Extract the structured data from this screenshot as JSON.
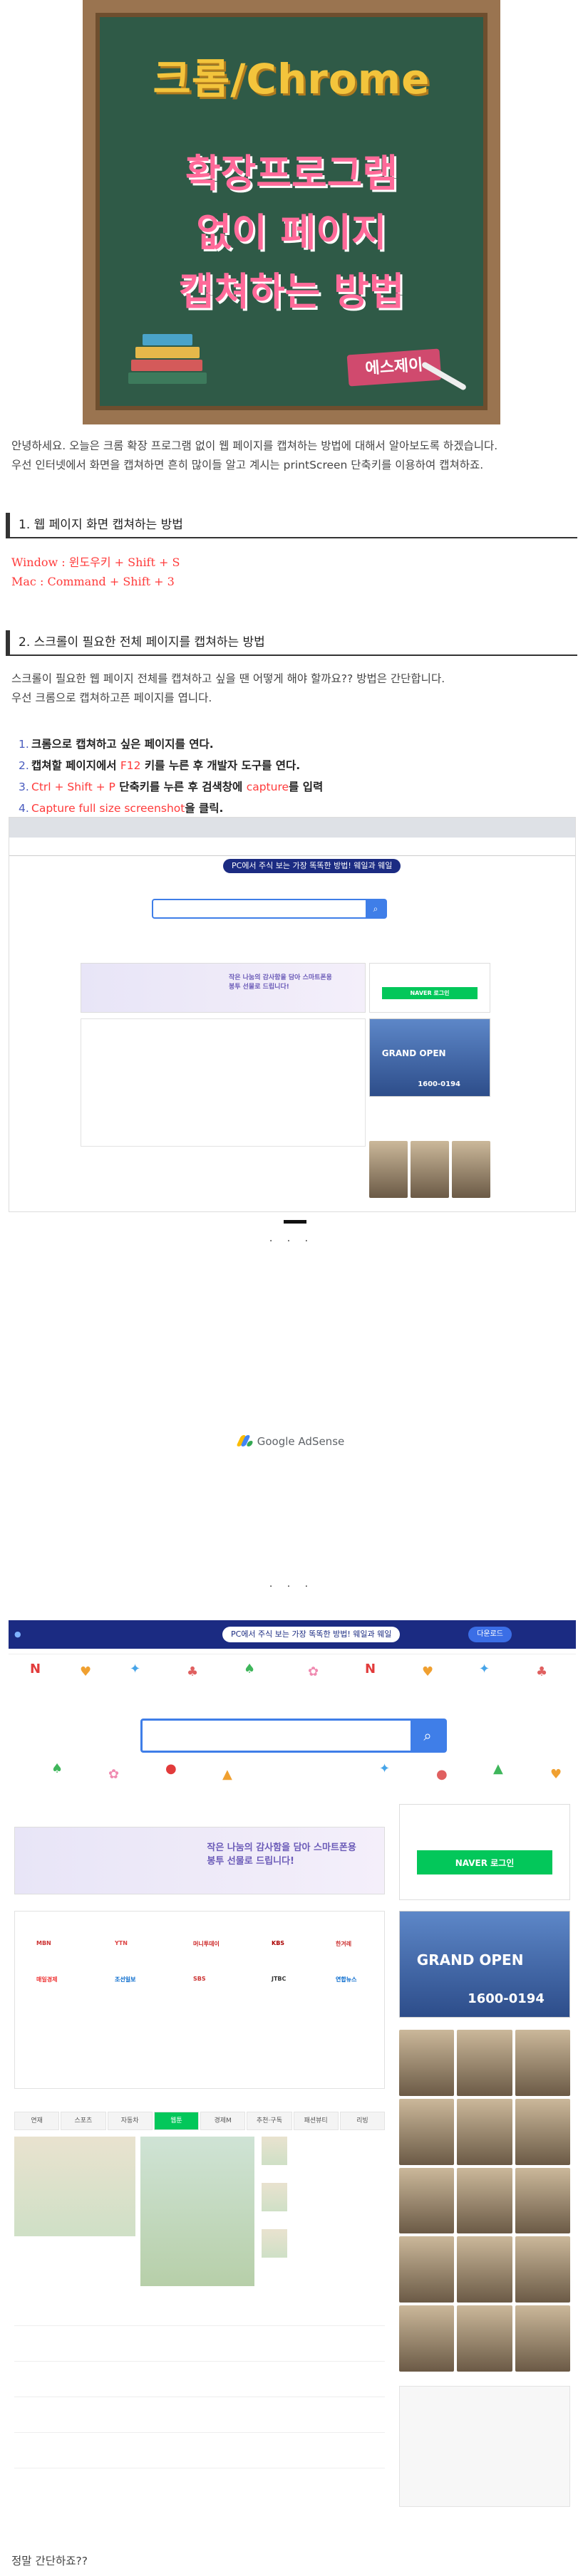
{
  "banner": {
    "title": "크롬/Chrome",
    "line1": "확장프로그램",
    "line2": "없이 페이지",
    "line3": "캡쳐하는 방법",
    "tag": "에스제이"
  },
  "intro": {
    "line1": "안녕하세요. 오늘은 크롬 확장 프로그램 없이 웹 페이지를 캡쳐하는 방법에 대해서 알아보도록 하겠습니다.",
    "line2": "우선 인터넷에서 화면을 캡쳐하면 흔히 많이들 알고 계시는 printScreen 단축키를 이용하여 캡쳐하죠."
  },
  "section1": {
    "heading": "1. 웹 페이지 화면 캡쳐하는 방법",
    "windows": "Window : 윈도우키 + Shift + S",
    "mac": "Mac : Command + Shift + 3"
  },
  "section2": {
    "heading": "2. 스크롤이 필요한 전체 페이지를 캡쳐하는 방법",
    "line1": "스크롤이 필요한 웹 페이지 전체를 캡쳐하고 싶을 땐 어떻게 해야 할까요?? 방법은 간단합니다.",
    "line2": "우선 크롬으로 캡쳐하고픈 페이지를 엽니다.",
    "steps": [
      {
        "num": "1.",
        "text": "크롬으로 캡쳐하고 싶은 페이지를 연다."
      },
      {
        "num": "2.",
        "pre": "캡쳐할 페이지에서 ",
        "key": "F12",
        "post": " 키를 누른 후 개발자 도구를 연다."
      },
      {
        "num": "3.",
        "key": "Ctrl + Shift + P",
        "pre": " 단축키를 누른 후 검색창에 ",
        "key2": "capture",
        "post": "를 입력"
      },
      {
        "num": "4.",
        "key": "Capture full size screenshot",
        "post": "을 클릭."
      }
    ]
  },
  "screenshot": {
    "banner_text": "PC에서 주식 보는 가장 똑똑한 방법! 웨일과 웨일",
    "banner_btn": "다운로드",
    "ad_text": "작은 나눔의 감사함을 담아 스마트폰용봉투 선물로 드립니다!",
    "login_btn": "NAVER 로그인",
    "hotel_brand": "GRAND OPEN",
    "hotel_phone": "1600-0194",
    "tabs": [
      "연재",
      "스포츠",
      "자동차",
      "웹툰",
      "경제M",
      "추천·구독",
      "패션뷰티",
      "리빙"
    ]
  },
  "closing": "정말 간단하죠??",
  "adsense_label": "Google AdSense",
  "dots": "· · ·"
}
